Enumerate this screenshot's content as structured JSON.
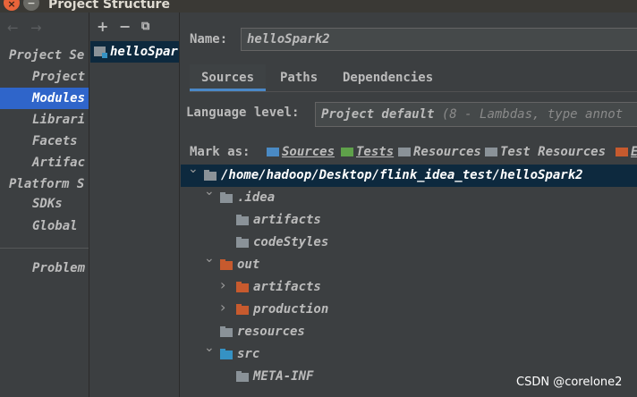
{
  "window": {
    "title": "Project Structure",
    "close_glyph": "×",
    "minimize_glyph": "−"
  },
  "nav": {
    "back_glyph": "←",
    "forward_glyph": "→",
    "project_settings": "Project Se",
    "items": [
      "Project",
      "Modules",
      "Librari",
      "Facets",
      "Artifac"
    ],
    "platform_settings": "Platform S",
    "platform_items": [
      "SDKs",
      "Global"
    ],
    "problems": "Problem",
    "selected": "Modules"
  },
  "modules": {
    "toolbar": {
      "add": "+",
      "remove": "−",
      "copy": "⧉"
    },
    "items": [
      "helloSpar"
    ]
  },
  "main": {
    "name_label": "Name:",
    "name_value": "helloSpark2",
    "tabs": [
      "Sources",
      "Paths",
      "Dependencies"
    ],
    "active_tab": "Sources",
    "language_label": "Language level:",
    "language_value": "Project default",
    "language_hint": "(8 - Lambdas, type annot",
    "mark_label": "Mark as:",
    "mark_options": [
      {
        "label": "Sources",
        "color": "#4a8ac4"
      },
      {
        "label": "Tests",
        "color": "#5fa14a"
      },
      {
        "label": "Resources",
        "color": "#8a9298"
      },
      {
        "label": "Test Resources",
        "color": "#8a9298"
      },
      {
        "label": "E",
        "color": "#c75a2e"
      }
    ]
  },
  "tree": [
    {
      "label": "/home/hadoop/Desktop/flink_idea_test/helloSpark2",
      "chevron": "v",
      "color": "#8a9298",
      "selected": true
    },
    {
      "label": ".idea",
      "chevron": "v",
      "color": "#8a9298"
    },
    {
      "label": "artifacts",
      "chevron": "",
      "color": "#8a9298"
    },
    {
      "label": "codeStyles",
      "chevron": "",
      "color": "#8a9298"
    },
    {
      "label": "out",
      "chevron": "v",
      "color": "#c75a2e"
    },
    {
      "label": "artifacts",
      "chevron": ">",
      "color": "#c75a2e"
    },
    {
      "label": "production",
      "chevron": ">",
      "color": "#c75a2e"
    },
    {
      "label": "resources",
      "chevron": "",
      "color": "#8a9298"
    },
    {
      "label": "src",
      "chevron": "v",
      "color": "#3592c4"
    },
    {
      "label": "META-INF",
      "chevron": "",
      "color": "#8a9298"
    }
  ],
  "watermark": "CSDN @corelone2",
  "colors": {
    "selection": "#2f65ca",
    "tree_selection": "#0d293e",
    "accent": "#4a88c7"
  }
}
